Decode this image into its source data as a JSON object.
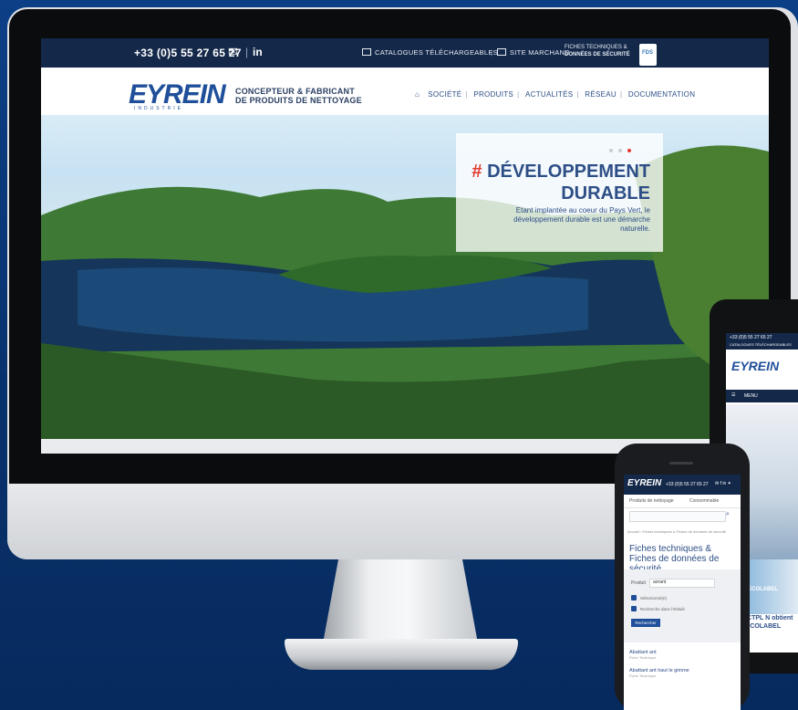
{
  "topbar": {
    "phone": "+33 (0)5 55 27 65 27",
    "social": "in",
    "catalogues": "CATALOGUES TÉLÉCHARGEABLES",
    "site_marchand": "SITE MARCHAND",
    "fiches_line1": "FICHES TECHNIQUES &",
    "fiches_line2": "DONNÉES DE SÉCURITÉ"
  },
  "header": {
    "logo_main": "EYREIN",
    "logo_sub": "INDUSTRIE",
    "tagline_line1": "CONCEPTEUR & FABRICANT",
    "tagline_line2": "DE PRODUITS DE NETTOYAGE",
    "nav": [
      "SOCIÉTÉ",
      "PRODUITS",
      "ACTUALITÉS",
      "RÉSEAU",
      "DOCUMENTATION"
    ]
  },
  "slide": {
    "hash": "#",
    "title_line1": "DÉVELOPPEMENT",
    "title_line2": "DURABLE",
    "text": "Etant implantée au coeur du Pays Vert, le développement durable est une démarche naturelle."
  },
  "tablet": {
    "phone": "+33 (0)5 55 27 65 27",
    "catalogues": "CATALOGUES TÉLÉCHARGEABLES",
    "logo": "EYREIN",
    "menu": "MENU",
    "news_label": "ECOLABEL",
    "caption": "ACTPL N obtient l'ECOLABEL"
  },
  "phone": {
    "logo": "EYREIN",
    "phone_number": "+33 (0)5 55 27 65 27",
    "tab1": "Produits de nettoyage",
    "tab2": "Consommable",
    "breadcrumb": "Accueil › Fiches techniques & Fiches de données de sécurité",
    "title": "Fiches techniques & Fiches de données de sécurité",
    "field_label": "Produit",
    "field_value": "aorant",
    "check1": "Sélectionné(e)",
    "check2": "Recherche dans l'intitulé",
    "button": "Rechercher",
    "result1": "Abattant ant",
    "result1_meta": "Fiche Technique",
    "result2": "Abattant ant haut le gimme",
    "result2_meta": "Fiche Technique"
  },
  "colors": {
    "brand_blue": "#1f4f9a",
    "brand_red": "#e23a2e",
    "topbar_navy": "#14294a",
    "background_blue": "#0b3f86"
  }
}
